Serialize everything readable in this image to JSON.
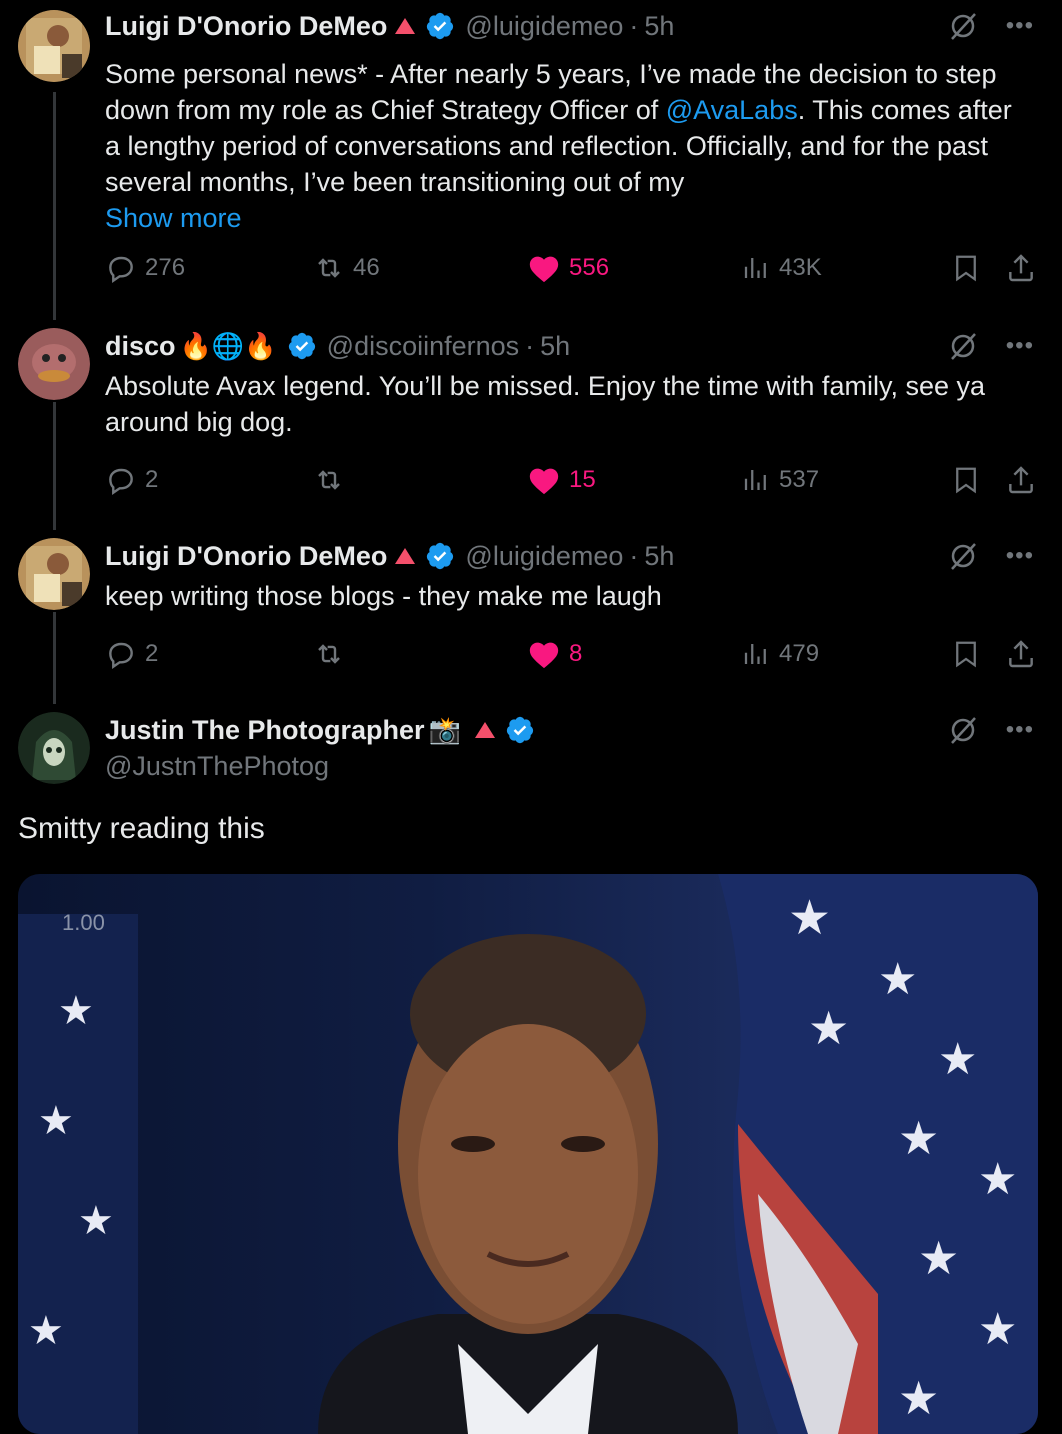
{
  "tweets": [
    {
      "name": "Luigi D'Onorio DeMeo",
      "handle": "@luigidemeo",
      "time": "5h",
      "text_before": "Some personal news* - After nearly 5 years, I’ve made the decision to step down from my role as Chief Strategy Officer of ",
      "mention": "@AvaLabs",
      "text_after": ". This comes after a lengthy period of conversations and reflection. Officially, and for the past several months, I’ve been transitioning out of my",
      "show_more": "Show more",
      "replies": "276",
      "reposts": "46",
      "likes": "556",
      "views": "43K"
    },
    {
      "name": "disco",
      "emojis": "🔥🌐🔥",
      "handle": "@discoiinfernos",
      "time": "5h",
      "text": "Absolute Avax legend. You’ll be missed. Enjoy the time with family, see ya around big dog.",
      "replies": "2",
      "reposts": "",
      "likes": "15",
      "views": "537"
    },
    {
      "name": "Luigi D'Onorio DeMeo",
      "handle": "@luigidemeo",
      "time": "5h",
      "text": "keep writing those blogs - they make me laugh",
      "replies": "2",
      "reposts": "",
      "likes": "8",
      "views": "479"
    },
    {
      "name": "Justin The Photographer",
      "emoji": "📸",
      "handle": "@JustnThePhotog",
      "text": "Smitty reading this",
      "media_speed": "1.00"
    }
  ],
  "colors": {
    "accent": "#1d9bf0",
    "like": "#f91880",
    "muted": "#71767b",
    "badge_triangle": "#f4506b"
  },
  "icons": [
    "reply-icon",
    "repost-icon",
    "heart-icon",
    "views-icon",
    "bookmark-icon",
    "share-icon",
    "grok-icon",
    "more-icon",
    "verified-icon"
  ]
}
